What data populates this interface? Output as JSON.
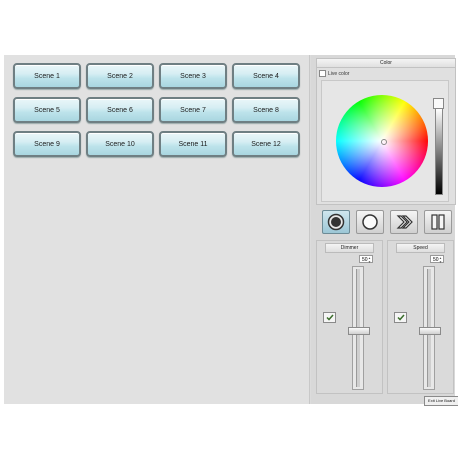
{
  "scenes": {
    "buttons": [
      "Scene 1",
      "Scene 2",
      "Scene 3",
      "Scene 4",
      "Scene 5",
      "Scene 6",
      "Scene 7",
      "Scene 8",
      "Scene 9",
      "Scene 10",
      "Scene 11",
      "Scene 12"
    ]
  },
  "color_panel": {
    "title": "Color",
    "live_color_label": "Live color"
  },
  "controls": {
    "icons": [
      "record-icon",
      "stop-icon",
      "forward-icon",
      "pause-icon"
    ]
  },
  "dimmer": {
    "title": "Dimmer",
    "value": "50"
  },
  "speed": {
    "title": "Speed",
    "value": "50"
  },
  "exit_label": "Exit Live Board",
  "colors": {
    "button_face": "#bde3eb",
    "button_border": "#6f7f83",
    "background": "#e1e1e1"
  }
}
